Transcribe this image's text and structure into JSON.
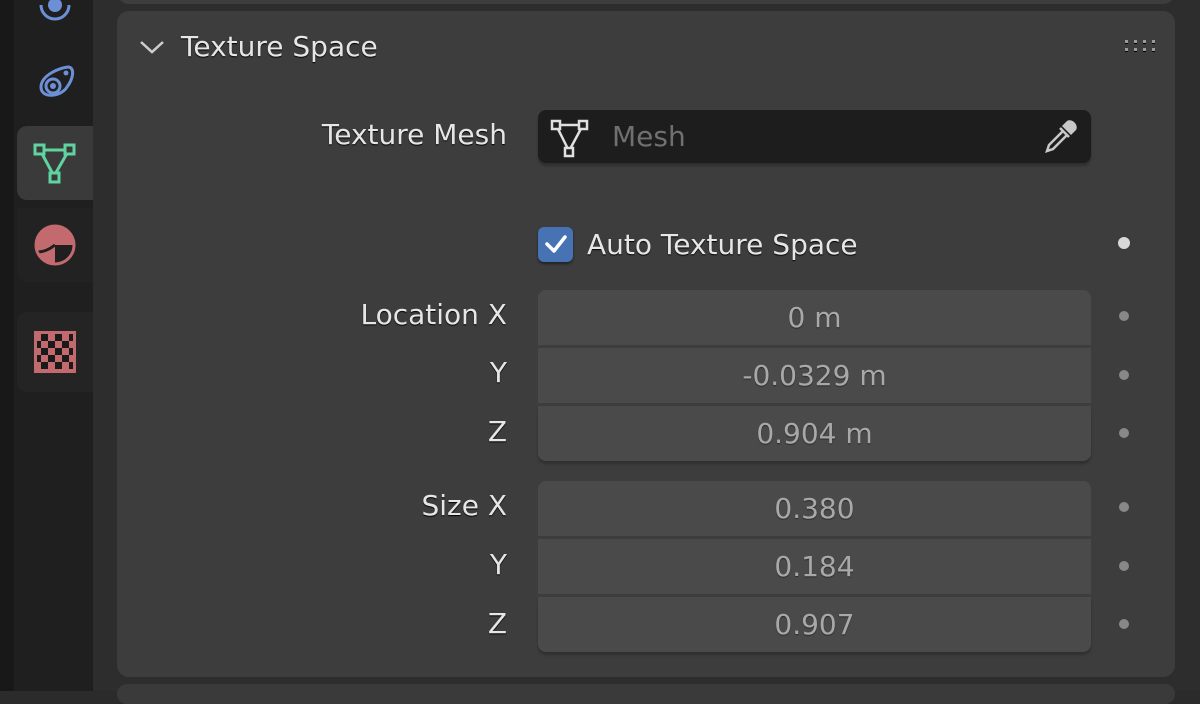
{
  "sidebar": {
    "tabs": [
      {
        "name": "constraints",
        "icon": "constraint-icon",
        "active": false
      },
      {
        "name": "physics",
        "icon": "physics-icon",
        "active": false
      },
      {
        "name": "object-data",
        "icon": "mesh-data-icon",
        "active": true
      },
      {
        "name": "material",
        "icon": "material-icon",
        "active": false
      },
      {
        "name": "texture",
        "icon": "texture-checker-icon",
        "active": false
      }
    ],
    "colors": {
      "blue": "#6d8fd6",
      "green": "#5fd3a0",
      "red": "#c26a6e"
    }
  },
  "panel": {
    "title": "Texture Space",
    "expanded": true,
    "texture_mesh": {
      "label": "Texture Mesh",
      "placeholder": "Mesh",
      "value": ""
    },
    "auto_texture_space": {
      "label": "Auto Texture Space",
      "checked": true
    },
    "location": {
      "labels": [
        "Location X",
        "Y",
        "Z"
      ],
      "values": [
        "0 m",
        "-0.0329 m",
        "0.904 m"
      ]
    },
    "size": {
      "labels": [
        "Size X",
        "Y",
        "Z"
      ],
      "values": [
        "0.380",
        "0.184",
        "0.907"
      ]
    }
  },
  "colors": {
    "accent": "#4772b3",
    "panel_bg": "#3d3d3d",
    "field_bg": "#4a4a4a"
  }
}
